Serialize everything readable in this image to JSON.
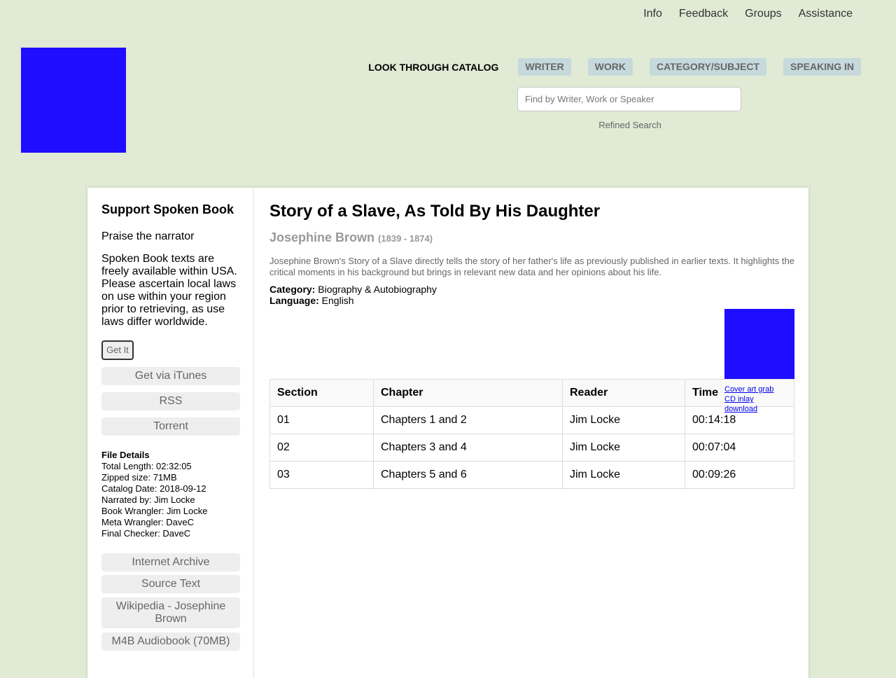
{
  "topnav": [
    "Info",
    "Feedback",
    "Groups",
    "Assistance"
  ],
  "browse": {
    "label": "LOOK THROUGH CATALOG",
    "buttons": [
      "WRITER",
      "WORK",
      "CATEGORY/SUBJECT",
      "SPEAKING IN"
    ]
  },
  "search": {
    "placeholder": "Find by Writer, Work or Speaker",
    "refined": "Refined Search"
  },
  "sidebar": {
    "title": "Support Spoken Book",
    "praise": "Praise the narrator",
    "notice": "Spoken Book texts are freely available within USA. Please ascertain local laws on use within your region prior to retrieving, as use laws differ worldwide.",
    "getit": "Get It",
    "buttons": [
      "Get via iTunes",
      "RSS",
      "Torrent"
    ],
    "file_details": {
      "heading": "File Details",
      "lines": [
        "Total Length: 02:32:05",
        "Zipped size: 71MB",
        "Catalog Date: 2018-09-12",
        "Narrated by: Jim Locke",
        "Book Wrangler: Jim Locke",
        "Meta Wrangler: DaveC",
        "Final Checker: DaveC"
      ]
    },
    "links": [
      "Internet Archive",
      "Source Text",
      "Wikipedia - Josephine Brown",
      "M4B Audiobook (70MB)"
    ]
  },
  "book": {
    "title": "Story of a Slave, As Told By His Daughter",
    "author": "Josephine Brown",
    "dates": "(1839 - 1874)",
    "description": "Josephine Brown's Story of a Slave directly tells the story of her father's life as previously published in earlier texts. It highlights the critical moments in his background but brings in relevant new data and her opinions about his life.",
    "category_label": "Category:",
    "category": "Biography & Autobiography",
    "language_label": "Language:",
    "language": "English",
    "cover_links": [
      "Cover art grab",
      "CD inlay",
      "download"
    ]
  },
  "table": {
    "headers": [
      "Section",
      "Chapter",
      "Reader",
      "Time"
    ],
    "rows": [
      [
        "01",
        "Chapters 1 and 2",
        "Jim Locke",
        "00:14:18"
      ],
      [
        "02",
        "Chapters 3 and 4",
        "Jim Locke",
        "00:07:04"
      ],
      [
        "03",
        "Chapters 5 and 6",
        "Jim Locke",
        "00:09:26"
      ]
    ]
  },
  "colors": {
    "background": "#e0ead4",
    "logo": "#1e0dff",
    "browse_button": "#c6d9dc"
  }
}
